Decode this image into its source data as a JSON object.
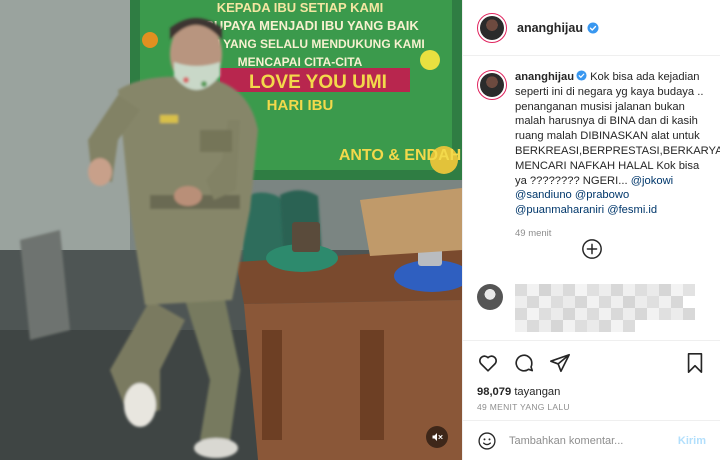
{
  "header": {
    "username": "ananghijau"
  },
  "banner": {
    "lines": [
      "KEPADA IBU SETIAP KAMI",
      "SUPAYA MENJADI IBU YANG BAIK",
      "IBU YANG SELALU MENDUKUNG KAMI",
      "MENCAPAI CITA-CITA",
      "LOVE YOU UMI",
      "HARI IBU",
      "ANTO & ENDAH"
    ]
  },
  "caption": {
    "username": "ananghijau",
    "text": "Kok bisa ada kejadian seperti ini di negara yg kaya budaya .. penanganan musisi jalanan bukan malah harusnya di BINA dan di kasih ruang malah DIBINASKAN alat untuk BERKREASI,BERPRESTASI,BERKARYA MENCARI NAFKAH HALAL Kok bisa ya ???????? NGERI...",
    "mentions": [
      "@jokowi",
      "@sandiuno",
      "@prabowo",
      "@puanmaharaniri",
      "@fesmi.id"
    ],
    "time": "49 menit"
  },
  "stats": {
    "views_count": "98,079",
    "views_label": "tayangan",
    "posted_ago": "49 MENIT YANG LALU"
  },
  "comment_box": {
    "placeholder": "Tambahkan komentar...",
    "post_label": "Kirim"
  },
  "icons": {
    "verified": "verified-badge-icon",
    "load_more": "plus-circle-icon",
    "like": "heart-icon",
    "comment": "comment-bubble-icon",
    "share": "paper-plane-icon",
    "save": "bookmark-icon",
    "emoji": "smiley-icon",
    "mute": "speaker-muted-icon"
  },
  "colors": {
    "verified": "#3897f0",
    "link": "#00376b",
    "post_button_disabled": "#b2dffc",
    "meta": "#8e8e8e"
  }
}
